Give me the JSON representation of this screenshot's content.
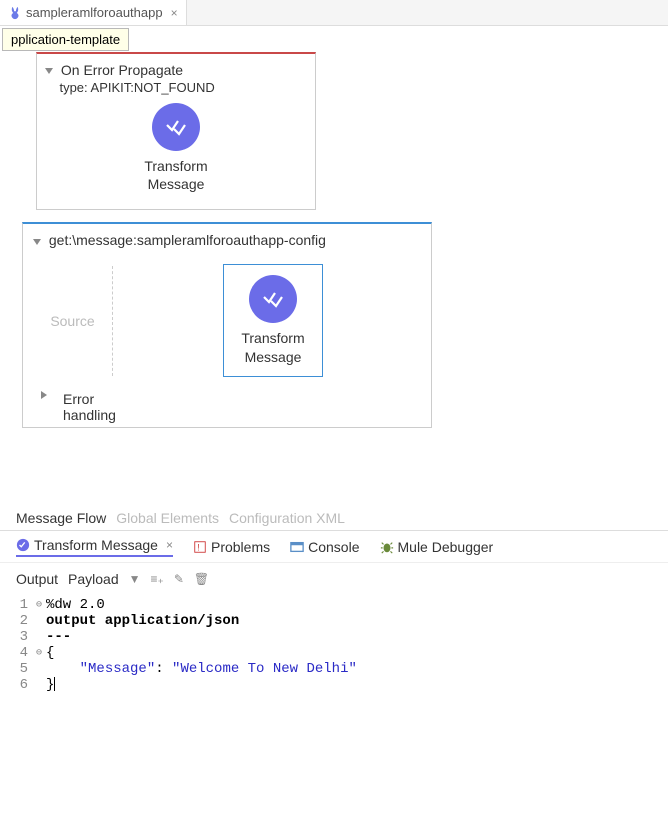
{
  "top_tab": {
    "label": "sampleramlforoauthapp",
    "icon": "rabbit-icon"
  },
  "tooltip": "pplication-template",
  "flow1": {
    "title": "On Error Propagate",
    "subtitle": "type: APIKIT:NOT_FOUND",
    "node_label_1": "Transform",
    "node_label_2": "Message"
  },
  "flow2": {
    "title": "get:\\message:sampleramlforoauthapp-config",
    "source_label": "Source",
    "node_label_1": "Transform",
    "node_label_2": "Message",
    "error_label_1": "Error",
    "error_label_2": "handling"
  },
  "editor_tabs": {
    "t1": "Message Flow",
    "t2": "Global Elements",
    "t3": "Configuration XML"
  },
  "panel_tabs": {
    "t1": "Transform Message",
    "t2": "Problems",
    "t3": "Console",
    "t4": "Mule Debugger"
  },
  "output_bar": {
    "output": "Output",
    "payload": "Payload"
  },
  "code": {
    "l1": "%dw 2.0",
    "l2": "output application/json",
    "l3": "---",
    "l4": "{",
    "l5_key": "\"Message\"",
    "l5_sep": ": ",
    "l5_val": "\"Welcome To New Delhi\"",
    "l6": "}"
  }
}
